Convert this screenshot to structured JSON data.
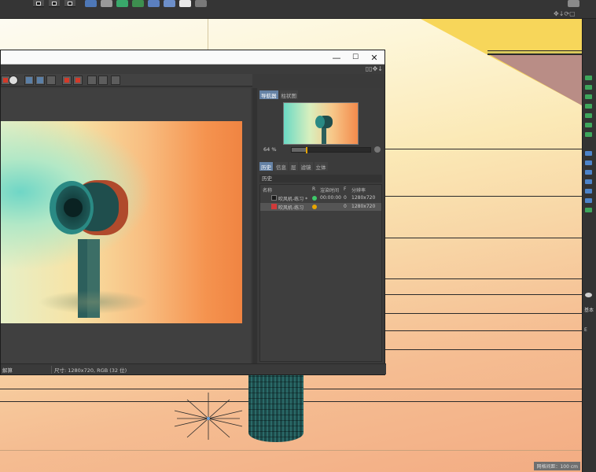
{
  "viewport": {
    "grid_spacing_label": "网格间距：100 cm"
  },
  "right_strip": {
    "label_a": "基本",
    "label_b": "E"
  },
  "window": {
    "controls": {
      "minimize": "—",
      "maximize": "☐",
      "close": "✕"
    },
    "status_left": "解算",
    "status_size": "尺寸: 1280x720, RGB (32 位)"
  },
  "navigator": {
    "tabs_top": [
      {
        "label": "导航器",
        "active": true
      },
      {
        "label": "柱状图",
        "active": false
      }
    ],
    "zoom": {
      "value_label": "64 %",
      "fraction": 0.18
    },
    "tabs_mid": [
      {
        "label": "历史",
        "active": true
      },
      {
        "label": "信息",
        "active": false
      },
      {
        "label": "层",
        "active": false
      },
      {
        "label": "滤镜",
        "active": false
      },
      {
        "label": "立体",
        "active": false
      }
    ],
    "history_title": "历史",
    "columns": {
      "name": "名称",
      "r": "R",
      "time": "渲染时间",
      "f": "F",
      "res": "分辨率"
    },
    "rows": [
      {
        "name": "吹风机-练习 *",
        "status_color": "#3ec96a",
        "time": "00:00:00",
        "f": "0",
        "res": "1280x720",
        "swatch": "#1a1a1a",
        "selected": false
      },
      {
        "name": "吹风机-练习",
        "status_color": "#e6a400",
        "time": "",
        "f": "0",
        "res": "1280x720",
        "swatch": "#d03a3a",
        "selected": true
      }
    ]
  },
  "colors": {
    "accent_tab": "#6582a5",
    "hairdryer": "#1f5a59"
  }
}
